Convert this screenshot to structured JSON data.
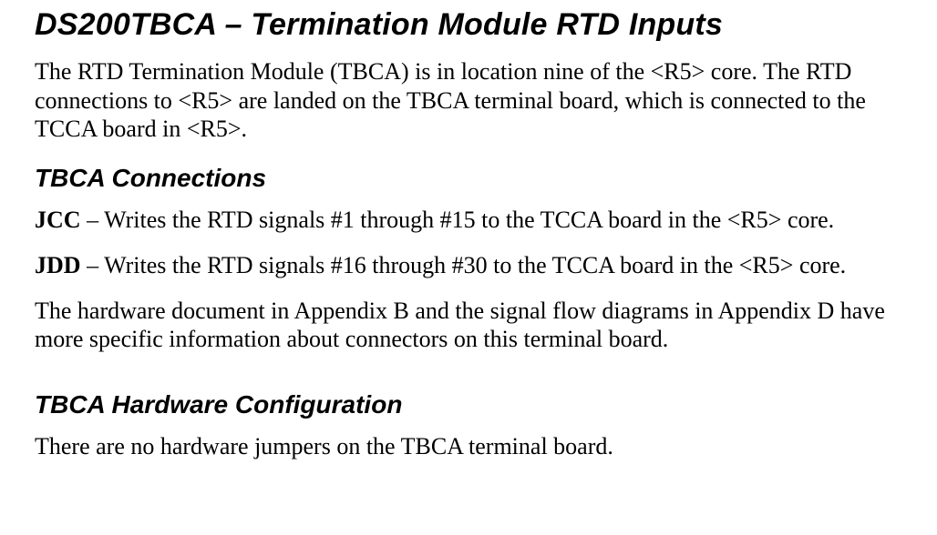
{
  "heading1": "DS200TBCA – Termination Module RTD Inputs",
  "intro": "The RTD Termination Module (TBCA) is in location nine of the <R5> core. The RTD connections to <R5> are landed on the TBCA terminal board, which is connected to the TCCA board in <R5>.",
  "heading2a": "TBCA Connections",
  "conn": [
    {
      "label": "JCC",
      "desc": " – Writes the RTD signals #1 through #15 to the TCCA board in the <R5> core."
    },
    {
      "label": "JDD",
      "desc": " – Writes the RTD signals #16 through #30 to the TCCA board in the <R5> core."
    }
  ],
  "appendix_note": "The hardware document in Appendix B and the signal flow diagrams in Appendix D have more specific information about connectors on this terminal board.",
  "heading2b": "TBCA Hardware Configuration",
  "hw_config_text": "There are no hardware jumpers on the TBCA terminal board."
}
